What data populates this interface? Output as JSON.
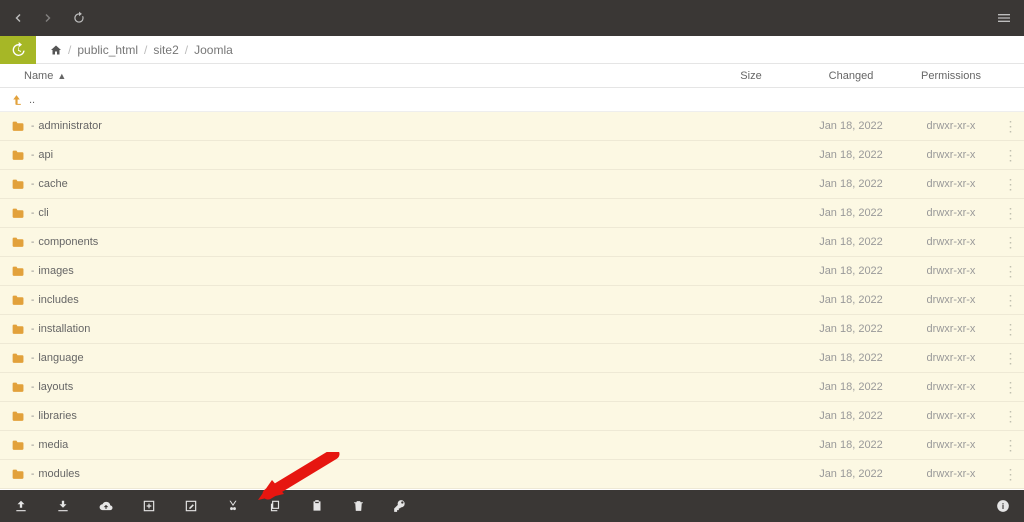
{
  "breadcrumb": {
    "items": [
      "public_html",
      "site2",
      "Joomla"
    ]
  },
  "columns": {
    "name": "Name",
    "size": "Size",
    "changed": "Changed",
    "perm": "Permissions"
  },
  "parent": {
    "label": ".."
  },
  "rows": [
    {
      "name": "administrator",
      "size": "",
      "changed": "Jan 18, 2022",
      "perm": "drwxr-xr-x"
    },
    {
      "name": "api",
      "size": "",
      "changed": "Jan 18, 2022",
      "perm": "drwxr-xr-x"
    },
    {
      "name": "cache",
      "size": "",
      "changed": "Jan 18, 2022",
      "perm": "drwxr-xr-x"
    },
    {
      "name": "cli",
      "size": "",
      "changed": "Jan 18, 2022",
      "perm": "drwxr-xr-x"
    },
    {
      "name": "components",
      "size": "",
      "changed": "Jan 18, 2022",
      "perm": "drwxr-xr-x"
    },
    {
      "name": "images",
      "size": "",
      "changed": "Jan 18, 2022",
      "perm": "drwxr-xr-x"
    },
    {
      "name": "includes",
      "size": "",
      "changed": "Jan 18, 2022",
      "perm": "drwxr-xr-x"
    },
    {
      "name": "installation",
      "size": "",
      "changed": "Jan 18, 2022",
      "perm": "drwxr-xr-x"
    },
    {
      "name": "language",
      "size": "",
      "changed": "Jan 18, 2022",
      "perm": "drwxr-xr-x"
    },
    {
      "name": "layouts",
      "size": "",
      "changed": "Jan 18, 2022",
      "perm": "drwxr-xr-x"
    },
    {
      "name": "libraries",
      "size": "",
      "changed": "Jan 18, 2022",
      "perm": "drwxr-xr-x"
    },
    {
      "name": "media",
      "size": "",
      "changed": "Jan 18, 2022",
      "perm": "drwxr-xr-x"
    },
    {
      "name": "modules",
      "size": "",
      "changed": "Jan 18, 2022",
      "perm": "drwxr-xr-x"
    }
  ]
}
